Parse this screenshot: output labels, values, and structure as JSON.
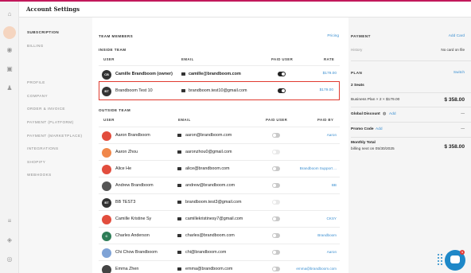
{
  "header": {
    "title": "Account Settings"
  },
  "subnav": {
    "items": [
      {
        "label": "SUBSCRIPTION",
        "active": true
      },
      {
        "label": "BILLING"
      },
      {
        "label": "PROFILE"
      },
      {
        "label": "COMPANY"
      },
      {
        "label": "ORDER & INVOICE"
      },
      {
        "label": "PAYMENT (PLATFORM)"
      },
      {
        "label": "PAYMENT (MARKETPLACE)"
      },
      {
        "label": "INTEGRATIONS"
      },
      {
        "label": "SHOPIFY"
      },
      {
        "label": "WEBHOOKS"
      }
    ]
  },
  "team": {
    "title": "TEAM MEMBERS",
    "pricing_link": "Pricing",
    "inside": {
      "title": "INSIDE TEAM",
      "columns": {
        "user": "USER",
        "email": "EMAIL",
        "paid": "PAID USER",
        "rate": "RATE"
      },
      "rows": [
        {
          "initials": "CB",
          "name": "Camille Brandboom (owner)",
          "email": "camille@brandboom.com",
          "rate": "$179.00",
          "paid": true
        },
        {
          "initials": "BT",
          "name": "Brandboom Test 10",
          "email": "brandboom.test10@gmail.com",
          "rate": "$179.00",
          "paid": true
        }
      ]
    },
    "outside": {
      "title": "OUTSIDE TEAM",
      "columns": {
        "user": "USER",
        "email": "EMAIL",
        "paid": "PAID USER",
        "paid_by": "PAID BY"
      },
      "rows": [
        {
          "name": "Aaron Brandboom",
          "email": "aaron@brandboom.com",
          "paid_by": "Aaron",
          "avatar_color": "#e24d3d"
        },
        {
          "name": "Aaron Zhou",
          "email": "aaronzhou0@gmail.com",
          "paid_by": "",
          "avatar_color": "#f0874a"
        },
        {
          "name": "Alice He",
          "email": "alice@brandboom.com",
          "paid_by": "Brandboom Support ...",
          "avatar_color": "#e24d3d"
        },
        {
          "name": "Andrew Brandboom",
          "email": "andrew@brandboom.com",
          "paid_by": "BB",
          "avatar_color": "#555555"
        },
        {
          "name": "BB TEST3",
          "initials": "BT",
          "email": "brandboom.test3@gmail.com",
          "paid_by": "",
          "avatar_color": "#333333"
        },
        {
          "name": "Camille Kristine Sy",
          "email": "camillekristinesy7@gmail.com",
          "paid_by": "CKSY",
          "avatar_color": "#e24d3d"
        },
        {
          "name": "Charles Anderson",
          "initials": "C",
          "email": "charles@brandboom.com",
          "paid_by": "Brandboom",
          "avatar_color": "#2e7d57"
        },
        {
          "name": "Chi Chow Brandboom",
          "email": "chi@brandboom.com",
          "paid_by": "Aaron",
          "avatar_color": "#7fa3d6"
        },
        {
          "name": "Emma Zhen",
          "email": "emma@brandboom.com",
          "paid_by": "emma@brandboom.com",
          "avatar_color": "#444444"
        }
      ]
    }
  },
  "payment": {
    "title": "PAYMENT",
    "add_card": "Add Card",
    "history": "History",
    "no_card": "No card on file"
  },
  "plan": {
    "title": "PLAN",
    "switch": "Switch",
    "seats": "2 Seats",
    "business_plan": "Business Plan × 2 × $179.00",
    "business_amount": "$ 358.00",
    "global_discount": "Global Discount",
    "promo_code": "Promo Code",
    "add": "Add",
    "dash": "—",
    "monthly_total": "Monthly Total",
    "billing_next": "billing next on 05/30/2025",
    "monthly_amount": "$ 358.00"
  },
  "chat": {
    "badge": "1"
  },
  "colors": {
    "accent": "#3b8fd1",
    "highlight": "#e03a2f",
    "brand": "#c2185b"
  }
}
